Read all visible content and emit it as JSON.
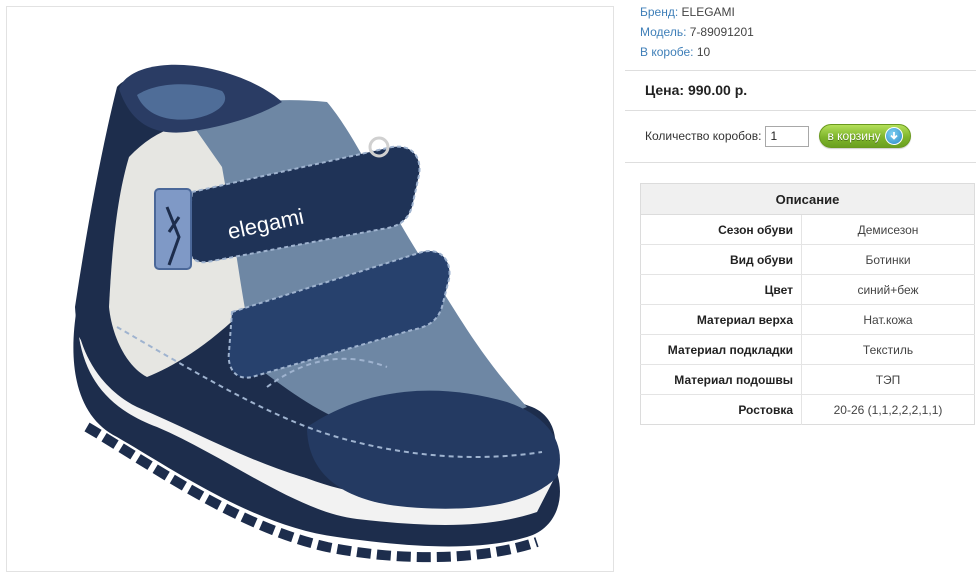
{
  "product": {
    "image_alt": "Ботинки ELEGAMI",
    "brand_logo_text": "elegami"
  },
  "meta": {
    "brand_label": "Бренд:",
    "brand_value": "ELEGAMI",
    "model_label": "Модель:",
    "model_value": "7-89091201",
    "box_label": "В коробе:",
    "box_value": "10"
  },
  "price": {
    "text": "Цена: 990.00 р."
  },
  "order": {
    "qty_label": "Количество коробов:",
    "qty_value": "1",
    "cart_label": "в корзину",
    "cart_icon": "download-arrow-icon"
  },
  "description": {
    "title": "Описание",
    "rows": [
      {
        "key": "Сезон обуви",
        "value": "Демисезон"
      },
      {
        "key": "Вид обуви",
        "value": "Ботинки"
      },
      {
        "key": "Цвет",
        "value": "синий+беж"
      },
      {
        "key": "Материал верха",
        "value": "Нат.кожа"
      },
      {
        "key": "Материал подкладки",
        "value": "Текстиль"
      },
      {
        "key": "Материал подошвы",
        "value": "ТЭП"
      },
      {
        "key": "Ростовка",
        "value": "20-26 (1,1,2,2,2,1,1)"
      }
    ]
  },
  "colors": {
    "link_blue": "#3f7fb8",
    "cart_green": "#7fb52c",
    "shoe_navy": "#1d2d4c",
    "shoe_grey_blue": "#6e87a4",
    "shoe_cream": "#e6e6e2"
  }
}
